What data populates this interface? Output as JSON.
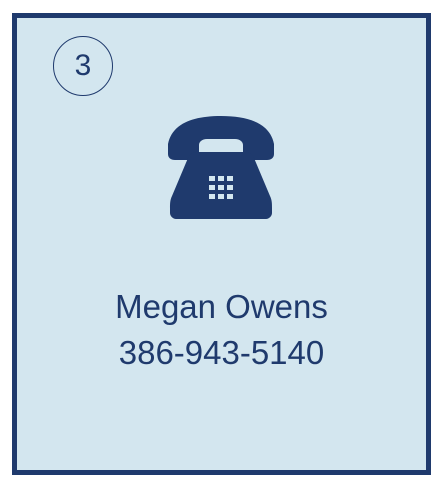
{
  "card": {
    "step_number": "3",
    "icon": "telephone-icon",
    "contact_name": "Megan Owens",
    "contact_phone": "386-943-5140"
  },
  "colors": {
    "accent": "#1f3a6d",
    "card_background": "#d3e6ef"
  }
}
